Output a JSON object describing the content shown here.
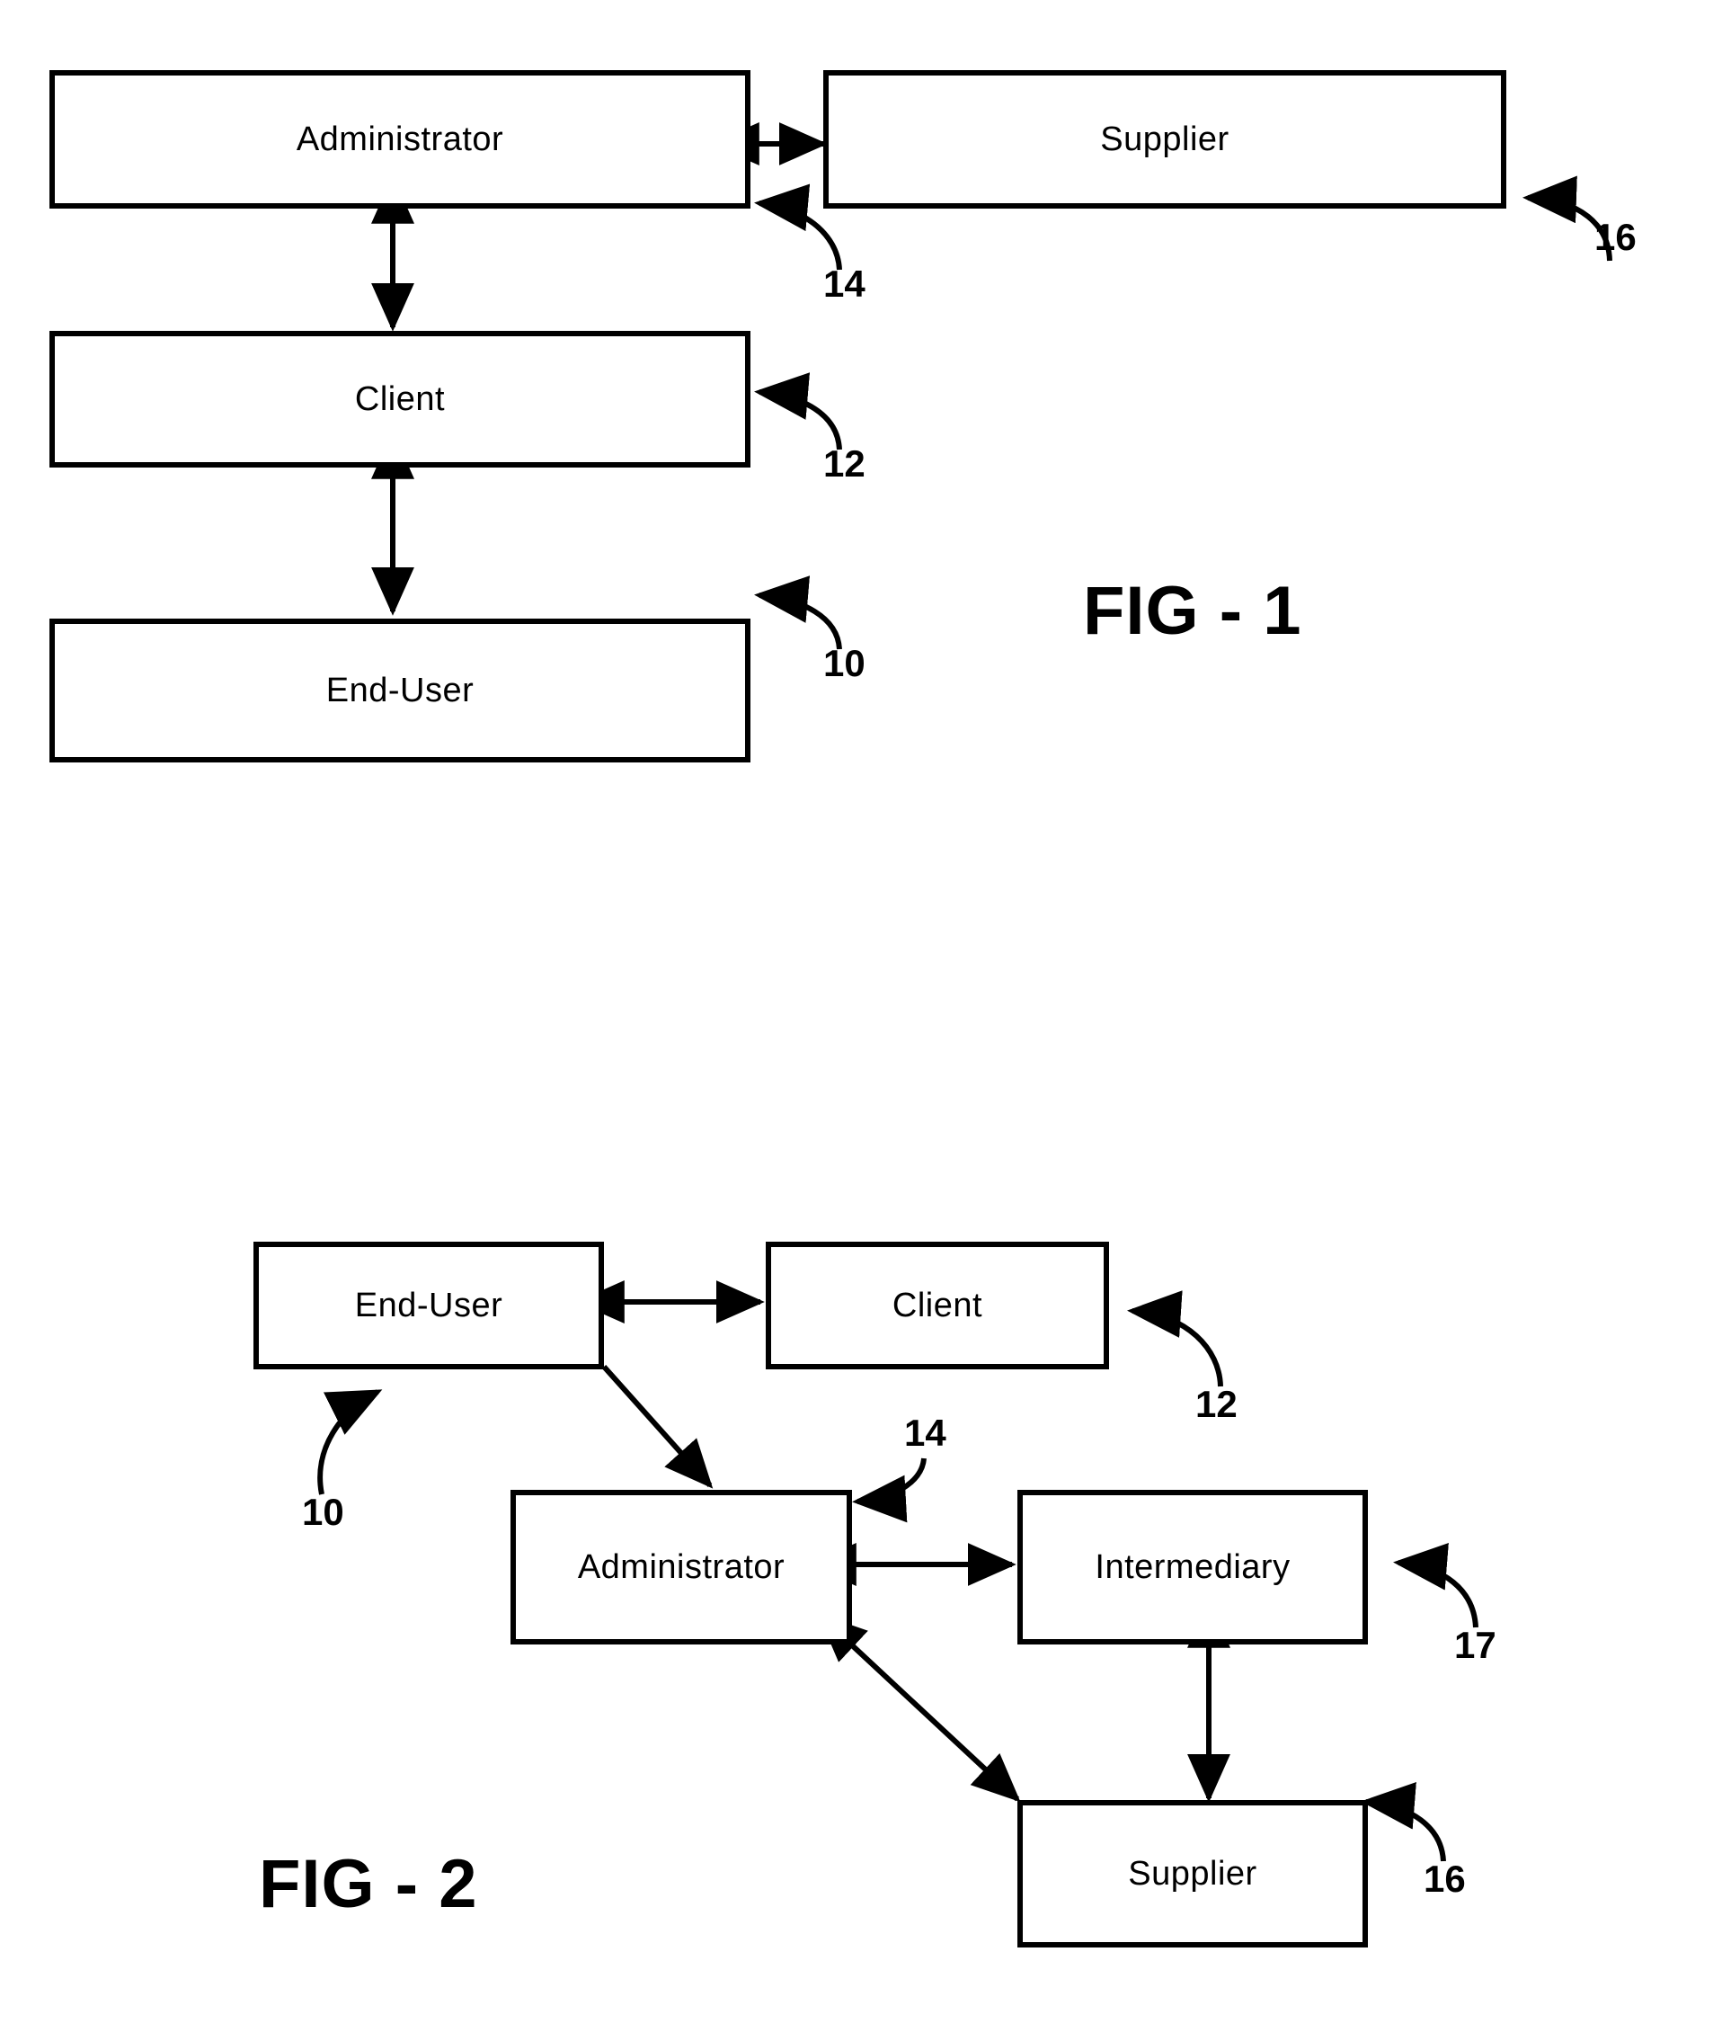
{
  "document": {
    "kind": "patent-drawing-sheet",
    "background_color": "#ffffff",
    "line_color": "#000000"
  },
  "figures": [
    {
      "id": "fig1",
      "caption": "FIG - 1",
      "nodes": [
        {
          "id": "fig1-administrator",
          "label": "Administrator"
        },
        {
          "id": "fig1-supplier",
          "label": "Supplier"
        },
        {
          "id": "fig1-client",
          "label": "Client"
        },
        {
          "id": "fig1-end-user",
          "label": "End-User"
        }
      ],
      "reference_numerals": [
        {
          "id": "fig1-ref-16",
          "value": "16",
          "points_to": "Supplier"
        },
        {
          "id": "fig1-ref-14",
          "value": "14",
          "points_to": "Administrator"
        },
        {
          "id": "fig1-ref-12",
          "value": "12",
          "points_to": "Client"
        },
        {
          "id": "fig1-ref-10",
          "value": "10",
          "points_to": "End-User"
        }
      ],
      "connections": [
        {
          "from": "Administrator",
          "to": "Supplier",
          "type": "double-arrow"
        },
        {
          "from": "Administrator",
          "to": "Client",
          "type": "double-arrow"
        },
        {
          "from": "Client",
          "to": "End-User",
          "type": "double-arrow"
        }
      ]
    },
    {
      "id": "fig2",
      "caption": "FIG - 2",
      "nodes": [
        {
          "id": "fig2-end-user",
          "label": "End-User"
        },
        {
          "id": "fig2-client",
          "label": "Client"
        },
        {
          "id": "fig2-administrator",
          "label": "Administrator"
        },
        {
          "id": "fig2-intermediary",
          "label": "Intermediary"
        },
        {
          "id": "fig2-supplier",
          "label": "Supplier"
        }
      ],
      "reference_numerals": [
        {
          "id": "fig2-ref-12",
          "value": "12",
          "points_to": "Client"
        },
        {
          "id": "fig2-ref-14",
          "value": "14",
          "points_to": "Administrator"
        },
        {
          "id": "fig2-ref-10",
          "value": "10",
          "points_to": "End-User"
        },
        {
          "id": "fig2-ref-17",
          "value": "17",
          "points_to": "Intermediary"
        },
        {
          "id": "fig2-ref-16",
          "value": "16",
          "points_to": "Supplier"
        }
      ],
      "connections": [
        {
          "from": "End-User",
          "to": "Client",
          "type": "double-arrow"
        },
        {
          "from": "End-User",
          "to": "Administrator",
          "type": "single-arrow-diagonal"
        },
        {
          "from": "Administrator",
          "to": "Intermediary",
          "type": "double-arrow"
        },
        {
          "from": "Supplier",
          "to": "Administrator",
          "type": "double-arrow-diagonal"
        },
        {
          "from": "Intermediary",
          "to": "Supplier",
          "type": "double-arrow"
        }
      ]
    }
  ]
}
